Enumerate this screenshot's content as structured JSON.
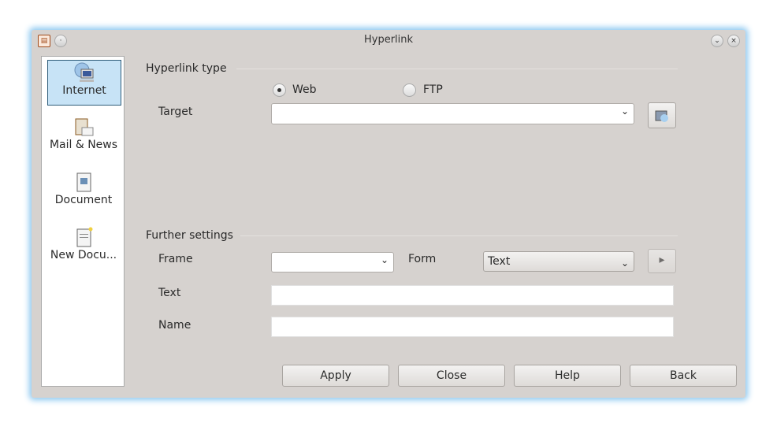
{
  "window": {
    "title": "Hyperlink"
  },
  "sidebar": {
    "items": [
      {
        "label": "Internet",
        "selected": true
      },
      {
        "label": "Mail & News"
      },
      {
        "label": "Document"
      },
      {
        "label": "New Docu..."
      }
    ]
  },
  "hyperlink_type": {
    "heading": "Hyperlink type",
    "web_label": "Web",
    "ftp_label": "FTP",
    "selected": "Web",
    "target_label": "Target",
    "target_value": ""
  },
  "further": {
    "heading": "Further settings",
    "frame_label": "Frame",
    "frame_value": "",
    "form_label": "Form",
    "form_value": "Text",
    "text_label": "Text",
    "text_value": "",
    "name_label": "Name",
    "name_value": ""
  },
  "buttons": {
    "apply": "Apply",
    "close": "Close",
    "help": "Help",
    "back": "Back"
  }
}
